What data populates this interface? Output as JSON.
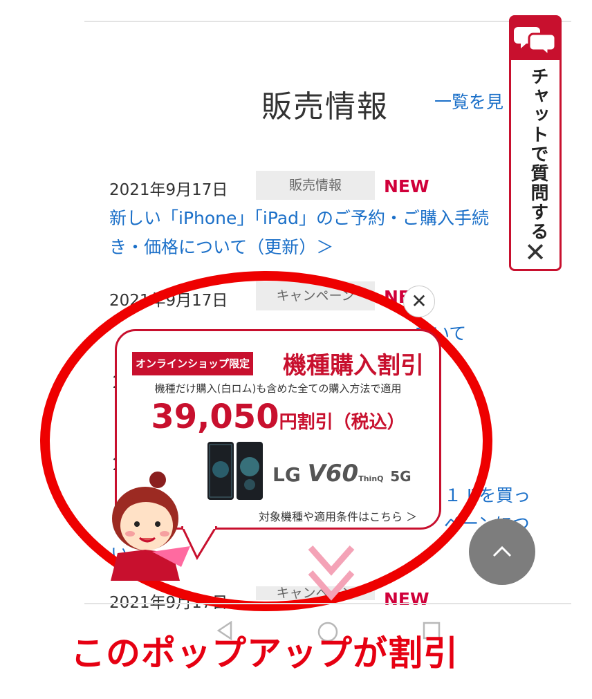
{
  "section": {
    "title": "販売情報",
    "view_all": "一覧を見"
  },
  "news": [
    {
      "date": "2021年9月17日",
      "tag": "販売情報",
      "new": "NEW",
      "link": "新しい「iPhone」「iPad」のご予約・ご購入手続き・価格について（更新）＞"
    },
    {
      "date": "2021年9月17日",
      "tag": "キャンペーン",
      "new": "NE",
      "link": "ていて"
    },
    {
      "date": "2021年9月17日",
      "tag": "キャンペーン",
      "new": "NEW"
    }
  ],
  "partial_texts": [
    "２",
    "２",
    "１ Ⅲを買っ",
    "ペーンにつ",
    "い"
  ],
  "chat_widget": {
    "label": "チャットで質問する",
    "close": "✕"
  },
  "popup": {
    "badge": "オンラインショップ限定",
    "title": "機種購入割引",
    "subtitle": "機種だけ購入(白ロム)も含めた全ての購入方法で適用",
    "price_number": "39,050",
    "price_suffix": "円割引（税込）",
    "brand_lg": "LG",
    "brand_model": "V60",
    "brand_thinq": "ThinQ",
    "brand_5g": "5G",
    "link": "対象機種や適用条件はこちら ＞",
    "close": "✕"
  },
  "caption": "このポップアップが割引",
  "colors": {
    "brand_red": "#c8102e",
    "link_blue": "#1a6fc8",
    "annotation_red": "#ee0000"
  }
}
